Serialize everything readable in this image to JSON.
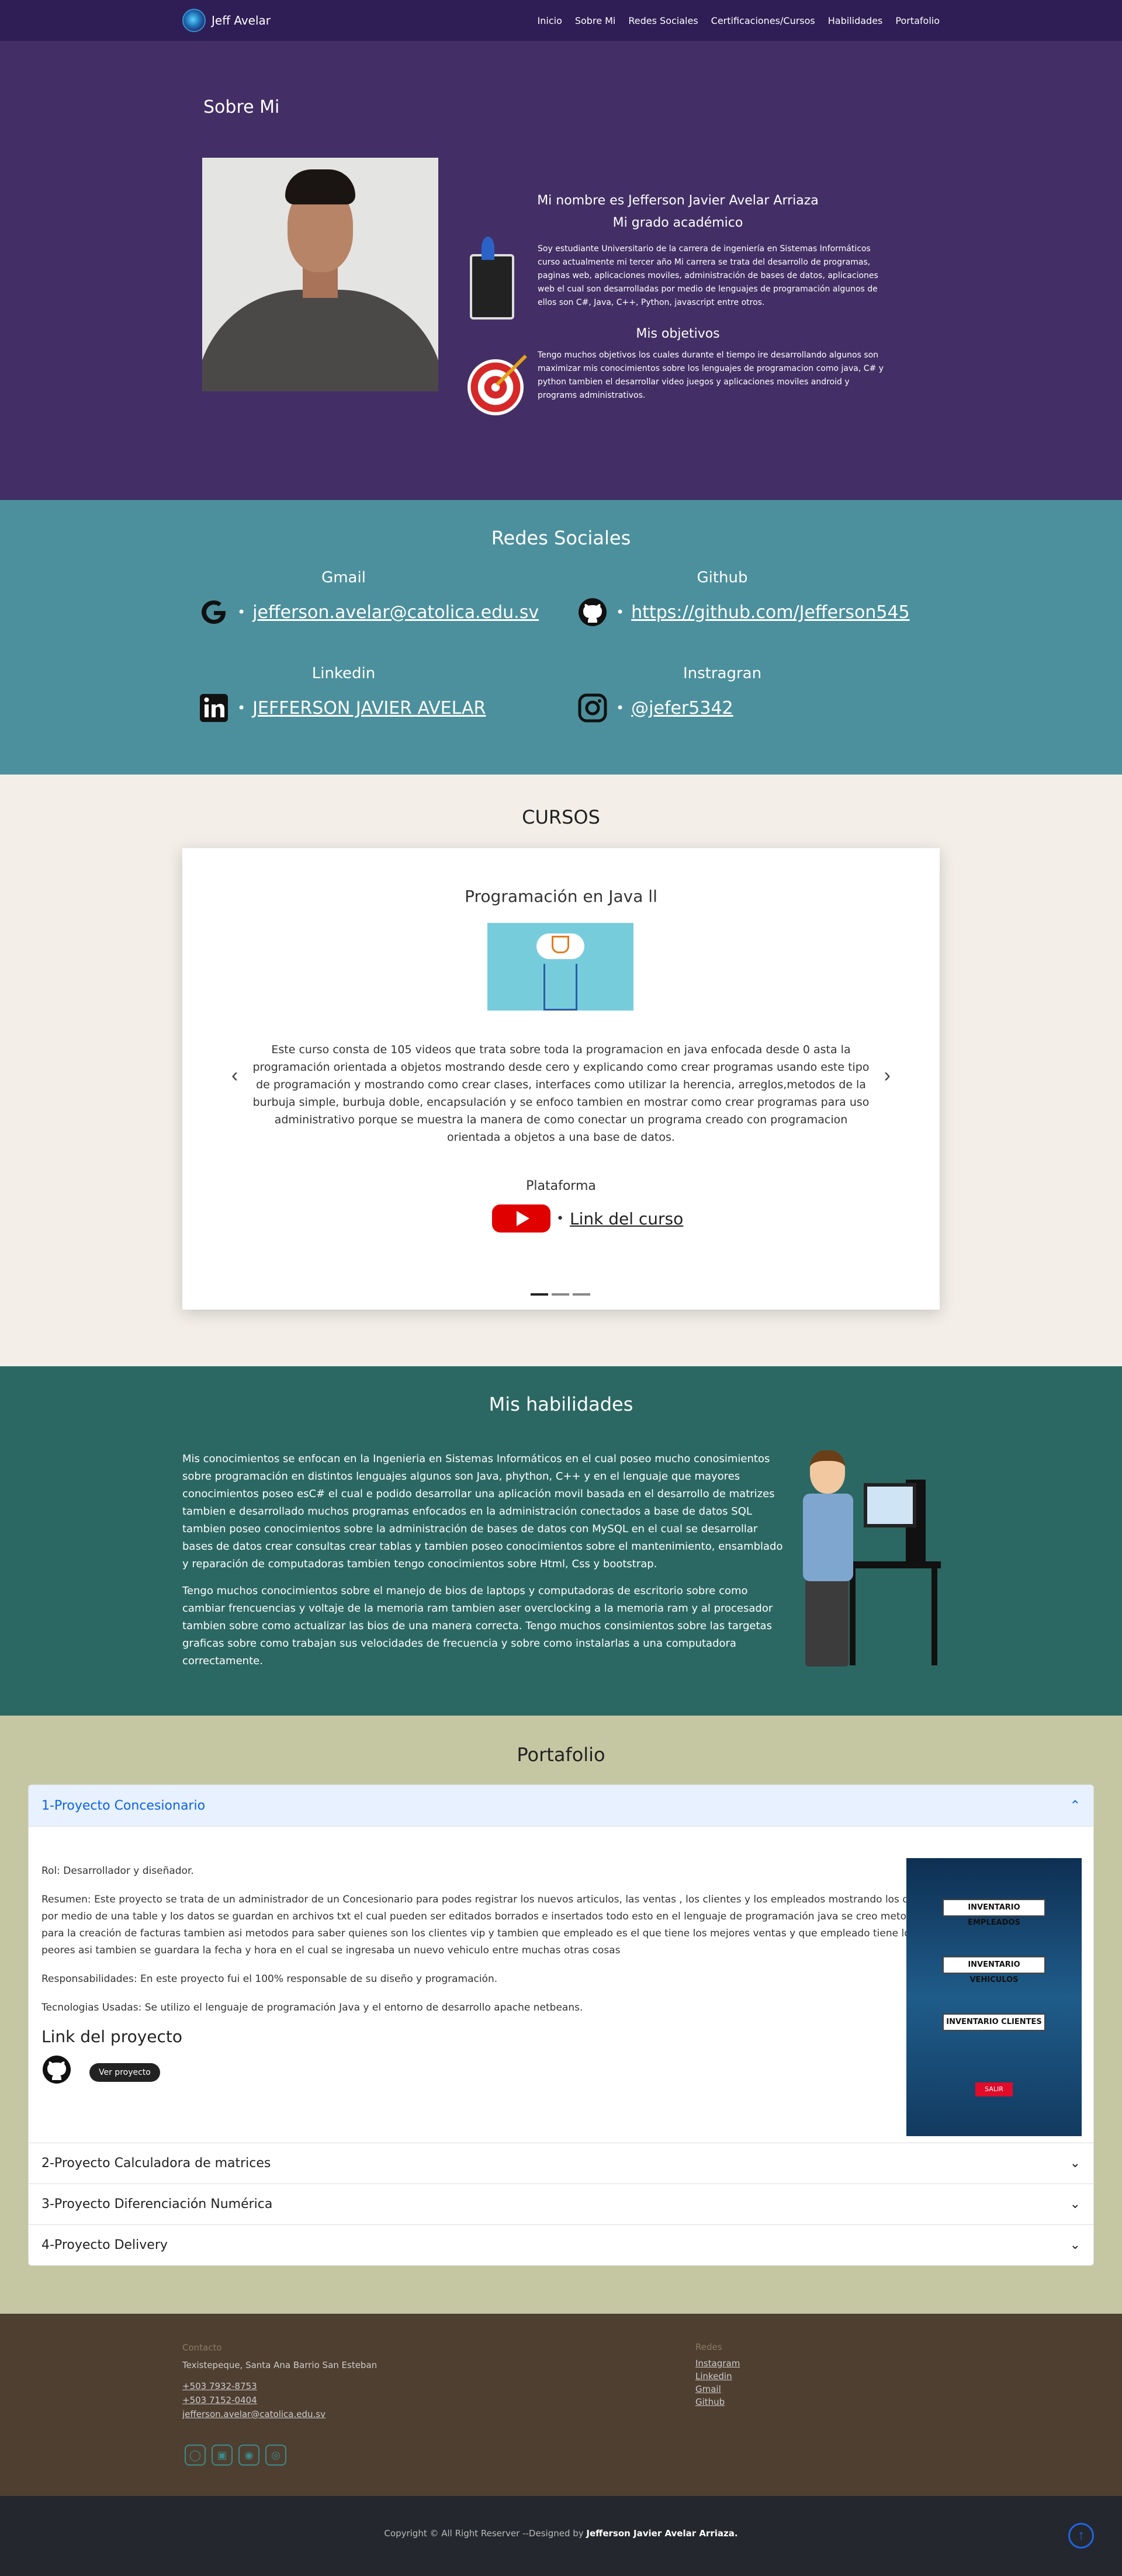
{
  "nav": {
    "brand": "Jeff Avelar",
    "links": [
      "Inicio",
      "Sobre Mi",
      "Redes Sociales",
      "Certificaciones/Cursos",
      "Habilidades",
      "Portafolio"
    ]
  },
  "about": {
    "title": "Sobre Mi",
    "name_line": "Mi nombre es Jefferson Javier Avelar Arriaza",
    "degree_title": "Mi grado académico",
    "degree_text": "Soy estudiante Universitario de la carrera de ingeniería en Sistemas Informáticos curso actualmente mi tercer año Mi carrera se trata del desarrollo de programas, paginas web, aplicaciones moviles, administración de bases de datos, aplicaciones web el cual son desarrolladas por medio de lenguajes de programación algunos de ellos son C#, Java, C++, Python, javascript entre otros.",
    "goals_title": "Mis objetivos",
    "goals_text": "Tengo muchos objetivos los cuales durante el tiempo ire desarrollando algunos son maximizar mis conocimientos sobre los lenguajes de programacion como java, C# y python tambien el desarrollar video juegos y aplicaciones moviles android y programs administrativos."
  },
  "social": {
    "title": "Redes Sociales",
    "items": [
      {
        "label": "Gmail",
        "value": "jefferson.avelar@catolica.edu.sv",
        "icon": "google-icon"
      },
      {
        "label": "Github",
        "value": "https://github.com/Jefferson545",
        "icon": "github-icon"
      },
      {
        "label": "Linkedin",
        "value": "JEFFERSON JAVIER AVELAR",
        "icon": "linkedin-icon"
      },
      {
        "label": "Instragran",
        "value": "@jefer5342",
        "icon": "instagram-icon"
      }
    ]
  },
  "cursos": {
    "title": "CURSOS",
    "course_title": "Programación en Java ll",
    "description": "Este curso consta de 105 videos que trata sobre toda la programacion en java enfocada desde 0 asta la programación orientada a objetos mostrando desde cero y explicando como crear programas usando este tipo de programación y mostrando como crear clases, interfaces como utilizar la herencia, arreglos,metodos de la burbuja simple, burbuja doble, encapsulación y se enfoco tambien en mostrar como crear programas para uso administrativo porque se muestra la manera de como conectar un programa creado con programacion orientada a objetos a una base de datos.",
    "platform_label": "Plataforma",
    "link_label": "Link del curso"
  },
  "habilidades": {
    "title": "Mis habilidades",
    "p1": "Mis conocimientos se enfocan en la Ingenieria en Sistemas Informáticos en el cual poseo mucho conosimientos sobre programación en distintos lenguajes algunos son Java, phython, C++ y en el lenguaje que mayores conocimientos poseo esC# el cual e podido desarrollar una aplicación movil basada en el desarrollo de matrizes tambien e desarrollado muchos programas enfocados en la administración conectados a base de datos SQL tambien poseo conocimientos sobre la administración de bases de datos con MySQL en el cual se desarrollar bases de datos crear consultas crear tablas y tambien poseo conocimientos sobre el mantenimiento, ensamblado y reparación de computadoras tambien tengo conocimientos sobre Html, Css y bootstrap.",
    "p2": "Tengo muchos conocimientos sobre el manejo de bios de laptops y computadoras de escritorio sobre como cambiar frencuencias y voltaje de la memoria ram tambien aser overclocking a la memoria ram y al procesador tambien sobre como actualizar las bios de una manera correcta. Tengo muchos consimientos sobre las targetas graficas sobre como trabajan sus velocidades de frecuencia y sobre como instalarlas a una computadora correctamente."
  },
  "portafolio": {
    "title": "Portafolio",
    "items": [
      {
        "label": "1-Proyecto Concesionario",
        "open": true
      },
      {
        "label": "2-Proyecto Calculadora de matrices",
        "open": false
      },
      {
        "label": "3-Proyecto Diferenciación Numérica",
        "open": false
      },
      {
        "label": "4-Proyecto Delivery",
        "open": false
      }
    ],
    "rol": "Rol: Desarrollador y diseñador.",
    "resumen": "Resumen: Este proyecto se trata de un administrador de un Concesionario para podes registrar los nuevos articulos, las ventas , los clientes y los empleados mostrando los datos por medio de una table y los datos se guardan en archivos txt el cual pueden ser editados borrados e insertados todo esto en el lenguaje de programación java se creo metodos para la creación de facturas tambien asi metodos para saber quienes son los clientes vip y tambien que empleado es el que tiene los mejores ventas y que empleado tiene los peores asi tambien se guardara la fecha y hora en el cual se ingresaba un nuevo vehiculo entre muchas otras cosas",
    "resp": "Responsabilidades: En este proyecto fui el 100% responsable de su diseño y programación.",
    "tech": "Tecnologias Usadas: Se utilizo el lenguaje de programación Java y el entorno de desarrollo apache netbeans.",
    "link_title": "Link del proyecto",
    "ver_btn": "Ver proyecto",
    "screen_buttons": [
      "INVENTARIO EMPLEADOS",
      "INVENTARIO VEHICULOS",
      "INVENTARIO CLIENTES"
    ],
    "screen_exit": "SALIR"
  },
  "footer": {
    "contact_title": "Contacto",
    "address": "Texistepeque, Santa Ana Barrio San Esteban",
    "phone1": "+503 7932-8753",
    "phone2": "+503 7152-0404",
    "email": "jefferson.avelar@catolica.edu.sv",
    "redes_title": "Redes",
    "redes": [
      "Instagram",
      "Linkedin",
      "Gmail",
      "Github"
    ],
    "copy_prefix": "Copyright © All Right Reserver --Designed by ",
    "copy_name": "Jefferson Javier Avelar Arriaza."
  }
}
